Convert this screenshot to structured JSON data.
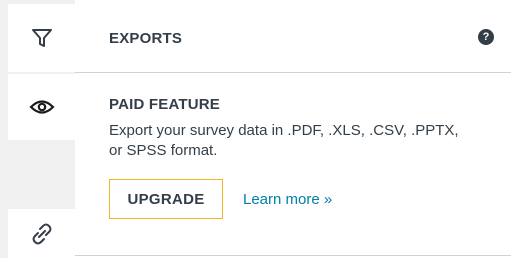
{
  "rail": {
    "icons": [
      "filter-icon",
      "eye-icon",
      "link-icon"
    ]
  },
  "header": {
    "title": "EXPORTS",
    "help_glyph": "?"
  },
  "paid": {
    "title": "PAID FEATURE",
    "description": "Export your survey data in .PDF, .XLS, .CSV, .PPTX, or SPSS format.",
    "upgrade_label": "UPGRADE",
    "learn_more_label": "Learn more »"
  },
  "colors": {
    "text": "#333e48",
    "upgrade_border": "#f0b323",
    "link": "#007faa",
    "rail_bg": "#f0f0f0"
  }
}
